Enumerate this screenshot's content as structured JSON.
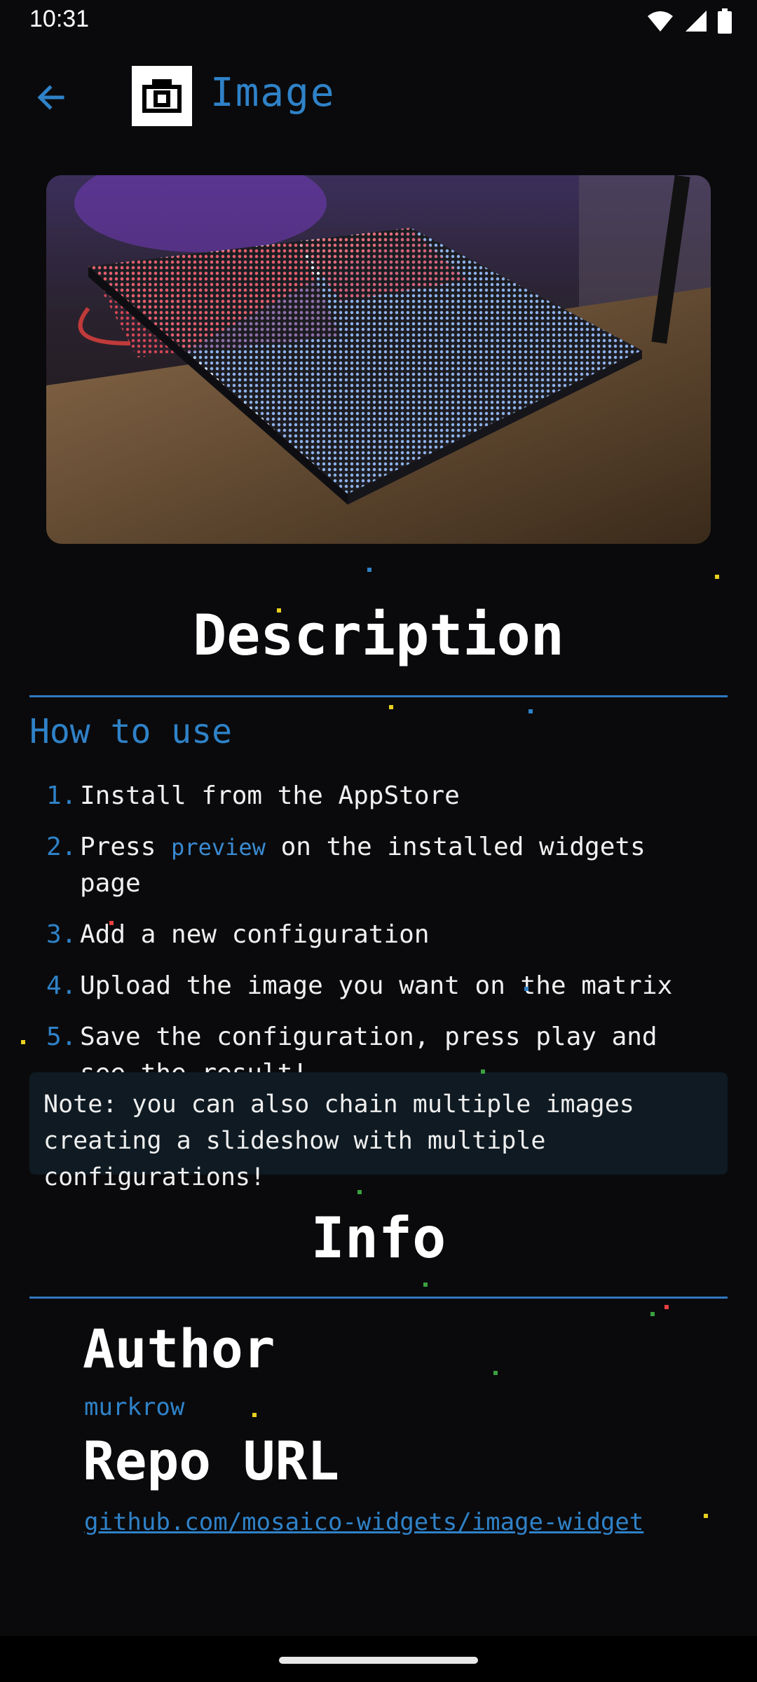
{
  "status_bar": {
    "time": "10:31"
  },
  "app_bar": {
    "title": "Image"
  },
  "sections": {
    "description_title": "Description",
    "info_title": "Info"
  },
  "how_to": {
    "heading": "How to use",
    "steps": [
      {
        "num": "1.",
        "text": "Install from the AppStore"
      },
      {
        "num": "2.",
        "pre": "Press ",
        "code": "preview",
        "post": " on the installed widgets page"
      },
      {
        "num": "3.",
        "text": "Add a new configuration"
      },
      {
        "num": "4.",
        "text": "Upload the image you want on the matrix"
      },
      {
        "num": "5.",
        "text": "Save the configuration, press play and see the result!"
      }
    ]
  },
  "note": "Note: you can also chain multiple images creating a slideshow with multiple configurations!",
  "info": {
    "author_label": "Author",
    "author_value": "murkrow",
    "repo_label": "Repo URL",
    "repo_value": "github.com/mosaico-widgets/image-widget"
  },
  "icons": {
    "back": "arrow-left-icon",
    "logo": "camera-icon",
    "wifi": "wifi-icon",
    "signal": "signal-icon",
    "battery": "battery-icon"
  },
  "colors": {
    "accent": "#2f82c8",
    "background": "#0a0a0c",
    "note_background": "#0f1a22"
  }
}
